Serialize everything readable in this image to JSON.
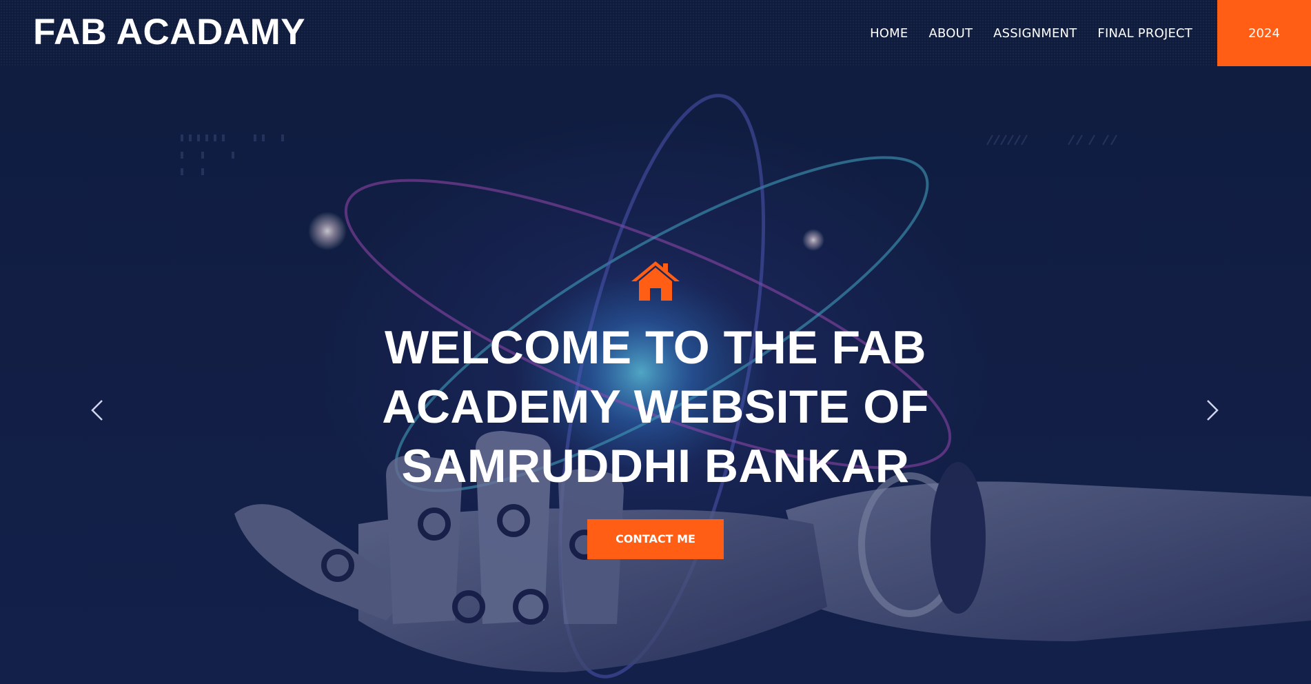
{
  "navbar": {
    "brand": "FAB ACADAMY",
    "links": [
      {
        "label": "HOME"
      },
      {
        "label": "ABOUT"
      },
      {
        "label": "ASSIGNMENT"
      },
      {
        "label": "FINAL PROJECT"
      }
    ],
    "year_button": "2024"
  },
  "hero": {
    "icon": "home-icon",
    "title": "WELCOME TO THE FAB ACADEMY WEBSITE OF SAMRUDDHI BANKAR",
    "contact_button": "CONTACT ME",
    "prev_icon": "chevron-left-icon",
    "next_icon": "chevron-right-icon",
    "background": "robotic hand holding glowing atom"
  },
  "colors": {
    "accent": "#ff5e14",
    "navbar_bg": "#101c3c",
    "hero_bg": "#14224a",
    "text": "#ffffff"
  }
}
